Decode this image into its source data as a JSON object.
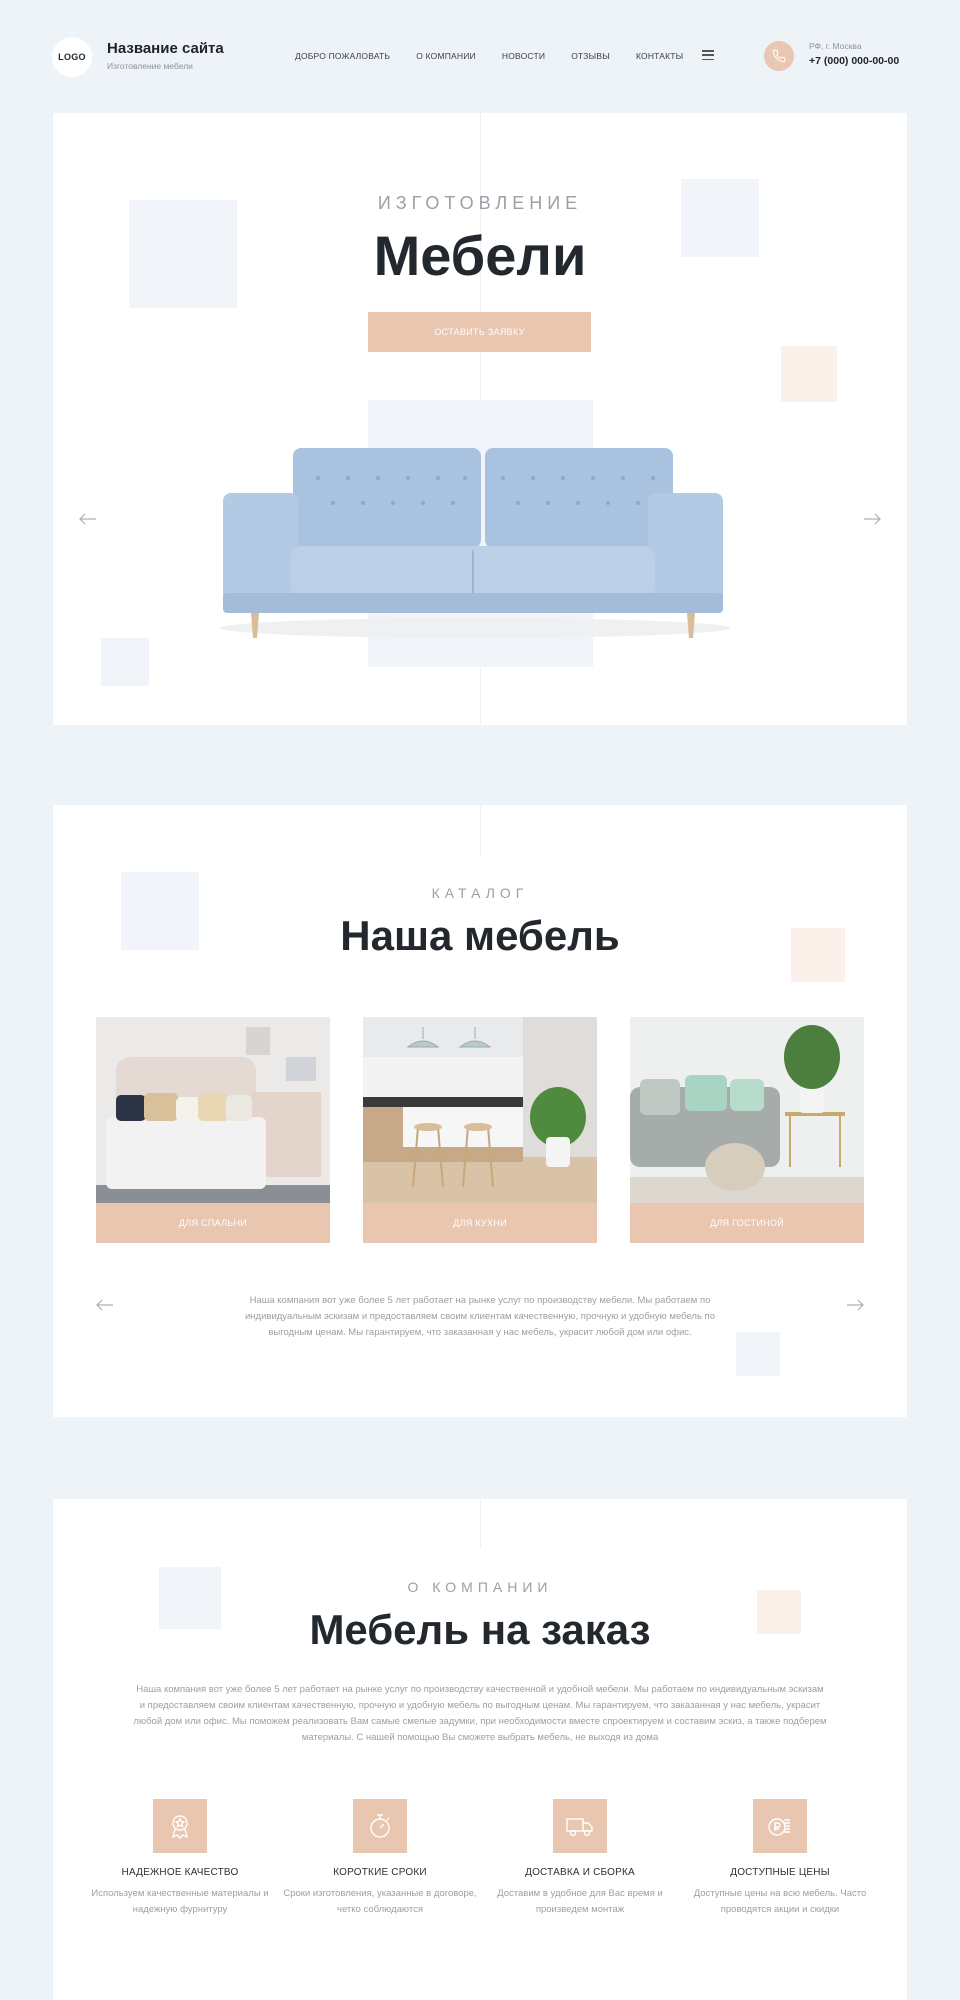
{
  "header": {
    "logo": "LOGO",
    "site_title": "Название сайта",
    "site_subtitle": "Изготовление мебели",
    "nav": [
      "ДОБРО ПОЖАЛОВАТЬ",
      "О КОМПАНИИ",
      "НОВОСТИ",
      "ОТЗЫВЫ",
      "КОНТАКТЫ"
    ],
    "city": "РФ, г. Москва",
    "phone": "+7 (000) 000-00-00"
  },
  "hero": {
    "kicker": "ИЗГОТОВЛЕНИЕ",
    "title": "Мебели",
    "button": "ОСТАВИТЬ ЗАЯВКУ"
  },
  "catalog": {
    "kicker": "КАТАЛОГ",
    "title": "Наша мебель",
    "items": [
      {
        "label": "ДЛЯ СПАЛЬНИ"
      },
      {
        "label": "ДЛЯ КУХНИ"
      },
      {
        "label": "ДЛЯ ГОСТИНОЙ"
      }
    ],
    "text": "Наша компания вот уже более 5 лет работает на рынке услуг по производству мебели. Мы работаем по индивидуальным эскизам и предоставляем своим клиентам качественную, прочную и удобную мебель по выгодным ценам. Мы гарантируем, что заказанная у нас мебель, украсит любой дом или офис."
  },
  "about": {
    "kicker": "О КОМПАНИИ",
    "title": "Мебель на заказ",
    "text": "Наша компания вот уже более 5 лет работает на рынке услуг по производству качественной и удобной мебели. Мы работаем по индивидуальным эскизам и предоставляем своим клиентам качественную, прочную и удобную мебель по выгодным ценам. Мы гарантируем, что заказанная у нас мебель, украсит любой дом или офис. Мы поможем реализовать Вам самые смелые задумки, при необходимости вместе спроектируем и составим эскиз, а также подберем материалы. С нашей помощью Вы сможете выбрать мебель, не выходя из дома",
    "features": [
      {
        "icon": "award-medal-icon",
        "title": "НАДЕЖНОЕ КАЧЕСТВО",
        "desc": "Используем качественные материалы и надежную фурнитуру"
      },
      {
        "icon": "stopwatch-icon",
        "title": "КОРОТКИЕ СРОКИ",
        "desc": "Сроки изготовления, указанные в договоре, четко соблюдаются"
      },
      {
        "icon": "delivery-truck-icon",
        "title": "ДОСТАВКА И СБОРКА",
        "desc": "Доставим в удобное для Вас время и произведем монтаж"
      },
      {
        "icon": "ruble-coins-icon",
        "title": "ДОСТУПНЫЕ ЦЕНЫ",
        "desc": "Доступные цены на всю мебель. Часто проводятся акции и скидки"
      }
    ]
  },
  "colors": {
    "background": "#eef3f8",
    "accent_peach": "#e8c6b0",
    "text_dark": "#23282e",
    "text_muted": "#9aa0a6"
  }
}
